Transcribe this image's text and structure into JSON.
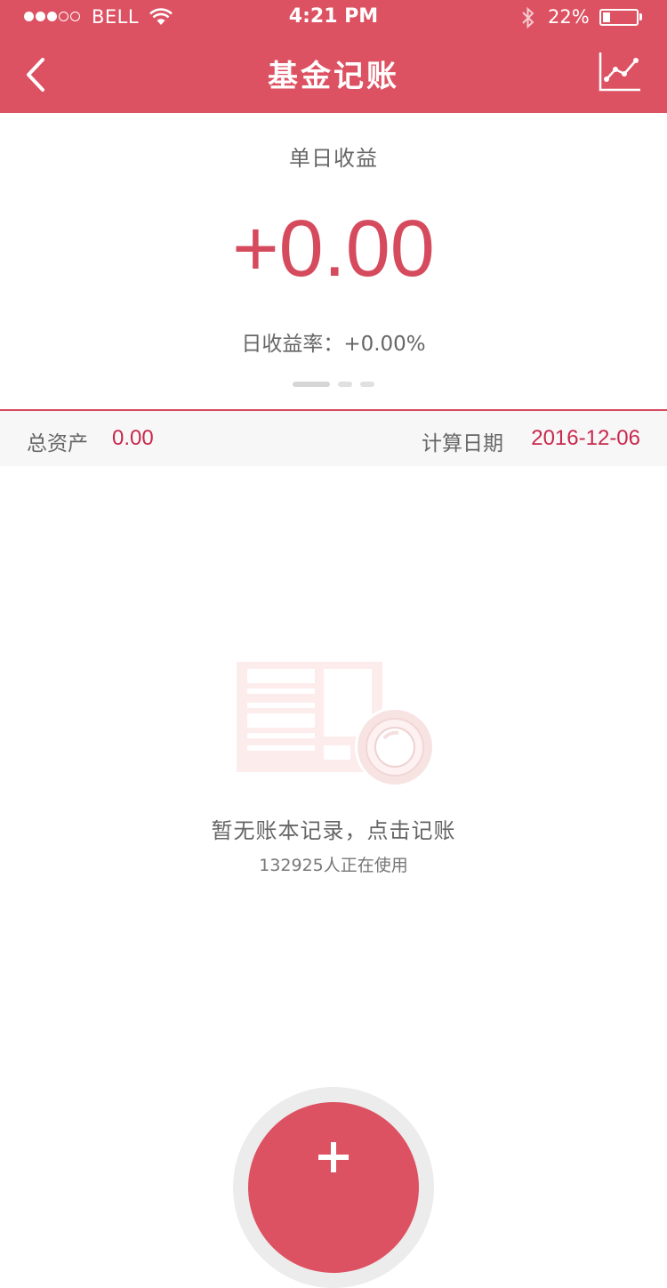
{
  "status_bar": {
    "carrier": "BELL",
    "time": "4:21 PM",
    "battery_percent": "22%",
    "battery_level": 0.22,
    "signal_bars_filled": 3,
    "signal_bars_total": 5
  },
  "nav": {
    "title": "基金记账",
    "back_icon": "chevron-left-icon",
    "chart_icon": "line-chart-icon"
  },
  "profit": {
    "label": "单日收益",
    "value": "+0.00",
    "rate_label": "日收益率：+0.00%",
    "page_count": 3,
    "active_page": 1
  },
  "summary": {
    "total_assets_label": "总资产",
    "total_assets_value": "0.00",
    "calc_date_label": "计算日期",
    "calc_date_value": "2016-12-06"
  },
  "empty_state": {
    "message": "暂无账本记录，点击记账",
    "users_text": "132925人正在使用",
    "illustration": "newspaper-coffee-illustration"
  },
  "fab": {
    "icon": "plus-icon"
  },
  "colors": {
    "brand": "#dd5262",
    "accent_text": "#c8284d",
    "profit_text": "#d64a5e"
  }
}
